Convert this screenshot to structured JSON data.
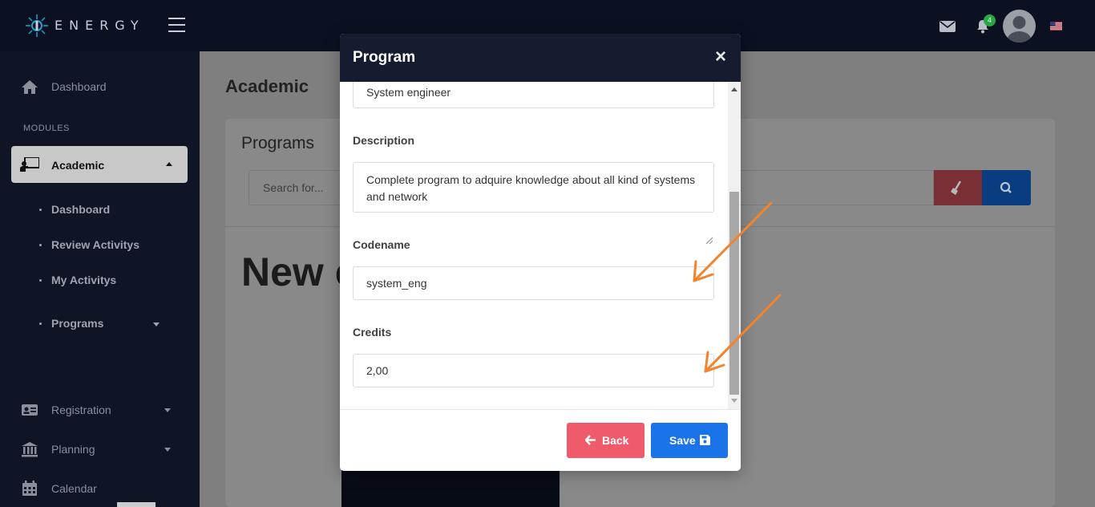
{
  "app": {
    "logo_text": "ENERGY"
  },
  "topbar": {
    "notification_count": "4"
  },
  "sidebar": {
    "dashboard": "Dashboard",
    "modules_label": "MODULES",
    "academic": "Academic",
    "sub_items": [
      "Dashboard",
      "Review Activitys",
      "My Activitys",
      "Programs"
    ],
    "registration": "Registration",
    "planning": "Planning",
    "calendar": "Calendar"
  },
  "main": {
    "page_title": "Academic",
    "card_title": "Programs",
    "search_placeholder": "Search for...",
    "big_heading": "New c"
  },
  "modal": {
    "title": "Program",
    "close": "×",
    "name_value": "System engineer",
    "description_label": "Description",
    "description_value": "Complete program to adquire knowledge about all kind of systems and network",
    "codename_label": "Codename",
    "codename_value": "system_eng",
    "credits_label": "Credits",
    "credits_value": "2,00",
    "back_label": "Back",
    "save_label": "Save"
  },
  "colors": {
    "topbar": "#0b1120",
    "sidebar": "#0f1525",
    "modal_header": "#151c30",
    "back_button": "#ef5b6b",
    "save_button": "#1a73e8",
    "annotation_arrow": "#f5832a"
  }
}
